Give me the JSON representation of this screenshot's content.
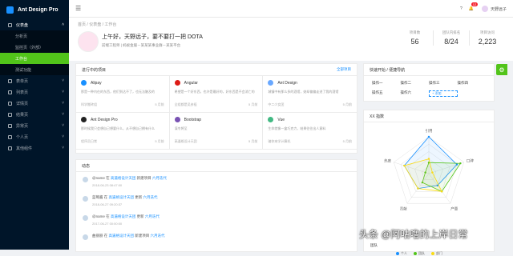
{
  "sidebar": {
    "logo": "Ant Design Pro",
    "items": [
      {
        "label": "仪表盘",
        "open": true
      },
      {
        "label": "表单页"
      },
      {
        "label": "列表页"
      },
      {
        "label": "详情页"
      },
      {
        "label": "结果页"
      },
      {
        "label": "异常页"
      },
      {
        "label": "个人页"
      },
      {
        "label": "其他组件"
      }
    ],
    "sub": [
      {
        "label": "分析页"
      },
      {
        "label": "监控页（外部）"
      },
      {
        "label": "工作台",
        "active": true
      },
      {
        "label": "测试功能"
      }
    ]
  },
  "header": {
    "badge": "12",
    "username": "天野远子"
  },
  "page": {
    "crumb": [
      "首页",
      "仪表盘",
      "工作台"
    ],
    "greeting": "上午好，天野远子，要不要打一把 DOTA",
    "subtitle": "前端工程师 | 蚂蚁金服－某某某事业群－某某平台",
    "stats": [
      {
        "label": "项目数",
        "value": "56"
      },
      {
        "label": "团队内排名",
        "value": "8/24"
      },
      {
        "label": "项目访问",
        "value": "2,223"
      }
    ]
  },
  "projects": {
    "title": "进行中的项目",
    "extra": "全部项目",
    "items": [
      {
        "name": "Alipay",
        "desc": "那是一种内在的东西，他们到达不了，也无法触及的",
        "team": "科学搬砖组",
        "time": "5 月前",
        "color": "#1890ff"
      },
      {
        "name": "Angular",
        "desc": "希望是一个好东西，也许是最好的，好东西是不会消亡的",
        "team": "全组都是吴彦祖",
        "time": "5 月前",
        "color": "#dd1b16"
      },
      {
        "name": "Ant Design",
        "desc": "城镇中有那么多的酒馆，她却偏偏走进了我的酒馆",
        "team": "中二少女团",
        "time": "5 月前",
        "color": "#69a8ff"
      },
      {
        "name": "Ant Design Pro",
        "desc": "那时候我只会想自己想要什么，从不想自己拥有什么",
        "team": "程序员日常",
        "time": "5 月前",
        "color": "#222"
      },
      {
        "name": "Bootstrap",
        "desc": "凛冬将至",
        "team": "高逼格设计天团",
        "time": "5 月前",
        "color": "#7952b3"
      },
      {
        "name": "Vue",
        "desc": "生命就像一盒巧克力，结果往往出人意料",
        "team": "骗你来学计算机",
        "time": "5 月前",
        "color": "#42b983"
      }
    ]
  },
  "dynamics": {
    "title": "动态",
    "items": [
      {
        "user": "@name",
        "mid": " 在 ",
        "group": "高逼格设计天团",
        "act": " 新建项目 ",
        "proj": "六月迭代",
        "time": "2018-06-23 08:47:00"
      },
      {
        "user": "蓝莓酱",
        "mid": " 在 ",
        "group": "高逼格设计天团",
        "act": " 更新 ",
        "proj": "六月迭代",
        "time": "2018-06-27 09:20:37"
      },
      {
        "user": "@name",
        "mid": " 在 ",
        "group": "高逼格设计天团",
        "act": " 更新 ",
        "proj": "六月迭代",
        "time": "2017-06-27 00:00:00"
      },
      {
        "user": "曲丽丽",
        "mid": " 在 ",
        "group": "高逼格设计天团",
        "act": " 新建项目 ",
        "proj": "六月迭代",
        "time": ""
      }
    ]
  },
  "quick": {
    "title": "快速开始 / 便捷导航",
    "items": [
      "操作一",
      "操作二",
      "操作三",
      "操作四",
      "操作五",
      "操作六"
    ],
    "add": "+ 添加"
  },
  "radar": {
    "title": "XX 指数",
    "axes": [
      "引用",
      "口碑",
      "产量",
      "贡献",
      "热度"
    ],
    "legend": [
      "个人",
      "团队",
      "部门"
    ],
    "colors": [
      "#1890ff",
      "#52c41a",
      "#fadb14"
    ]
  },
  "chart_data": {
    "type": "radar",
    "categories": [
      "引用",
      "口碑",
      "产量",
      "贡献",
      "热度"
    ],
    "series": [
      {
        "name": "个人",
        "values": [
          10,
          8,
          4,
          5,
          7
        ]
      },
      {
        "name": "团队",
        "values": [
          3,
          9,
          6,
          3,
          1
        ]
      },
      {
        "name": "部门",
        "values": [
          4,
          1,
          6,
          5,
          7
        ]
      }
    ],
    "ylim": [
      0,
      10
    ]
  },
  "watermark": "头条 @阿咕噜的上岸日常",
  "footer_text": "团队"
}
